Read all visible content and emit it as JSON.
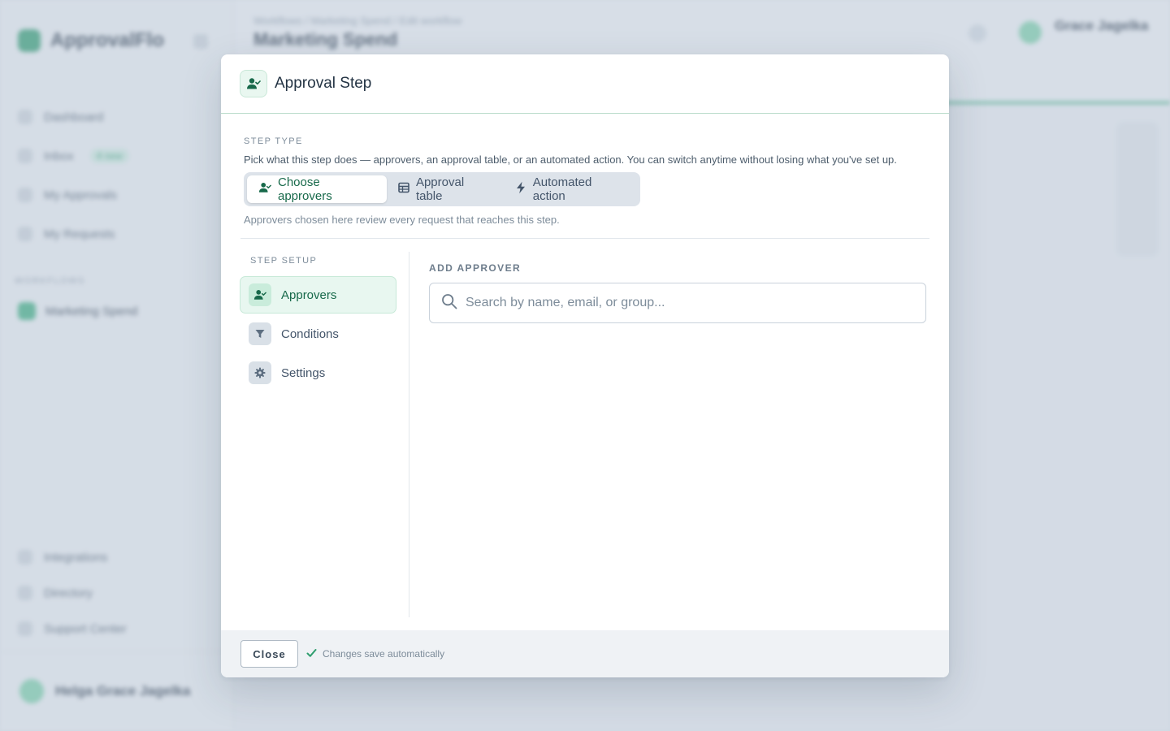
{
  "background": {
    "brand": "ApprovalFlo",
    "nav": [
      {
        "label": "Dashboard"
      },
      {
        "label": "Inbox",
        "badge": "4 new"
      },
      {
        "label": "My Approvals"
      },
      {
        "label": "My Requests"
      }
    ],
    "section": "WORKFLOWS",
    "workflow": "Marketing Spend",
    "footer_nav": [
      "Integrations",
      "Directory",
      "Support Center"
    ],
    "user": "Helga Grace Jagelka",
    "breadcrumb": "Workflows  /  Marketing Spend  /  Edit workflow",
    "page_title": "Marketing Spend",
    "top_right_name": "Grace Jagelka"
  },
  "modal": {
    "title": "Approval Step",
    "step_type": {
      "label": "STEP TYPE",
      "description": "Pick what this step does — approvers, an approval table, or an automated action. You can switch anytime without losing what you've set up.",
      "options": [
        {
          "label": "Choose approvers",
          "icon": "user-check-icon",
          "active": true
        },
        {
          "label": "Approval table",
          "icon": "table-icon",
          "active": false
        },
        {
          "label": "Automated action",
          "icon": "bolt-icon",
          "active": false
        }
      ],
      "hint": "Approvers chosen here review every request that reaches this step."
    },
    "setup": {
      "label": "STEP SETUP",
      "items": [
        {
          "label": "Approvers",
          "icon": "user-check-icon",
          "active": true
        },
        {
          "label": "Conditions",
          "icon": "filter-icon",
          "active": false
        },
        {
          "label": "Settings",
          "icon": "gear-icon",
          "active": false
        }
      ]
    },
    "add_approver": {
      "label": "ADD APPROVER",
      "placeholder": "Search by name, email, or group...",
      "value": ""
    },
    "footer": {
      "close_label": "Close",
      "autosave": "Changes save automatically"
    }
  },
  "colors": {
    "accent": "#17694a",
    "accent_light": "#e8f7f0",
    "overlay": "#b4c2d2"
  }
}
